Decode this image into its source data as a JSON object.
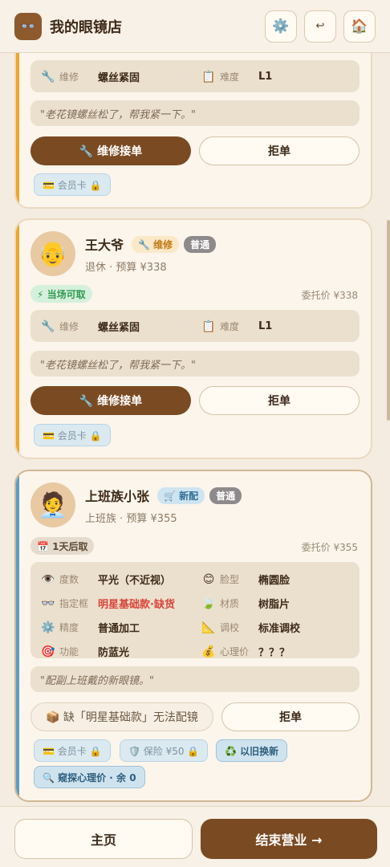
{
  "header": {
    "logo_icon": "glasses-icon",
    "title": "我的眼镜店",
    "settings_icon": "⚙️",
    "back_icon": "↩",
    "home_icon": "🏠"
  },
  "cards": [
    {
      "service": "维修",
      "service_value": "螺丝紧固",
      "difficulty_label": "难度",
      "difficulty_value": "L1",
      "quote": "\"老花镜螺丝松了，帮我紧一下。\"",
      "accept_label": "🔧 维修接单",
      "reject_label": "拒单",
      "chips": [
        "💳 会员卡 🔒"
      ]
    },
    {
      "name": "王大爷",
      "type_tag": "🔧 维修",
      "level_tag": "普通",
      "sub": "退休 · 预算 ¥338",
      "status_badge": "⚡ 当场可取",
      "commission": "委托价 ¥338",
      "service": "维修",
      "service_value": "螺丝紧固",
      "difficulty_label": "难度",
      "difficulty_value": "L1",
      "quote": "\"老花镜螺丝松了，帮我紧一下。\"",
      "accept_label": "🔧 维修接单",
      "reject_label": "拒单",
      "chips": [
        "💳 会员卡 🔒"
      ]
    },
    {
      "name": "上班族小张",
      "type_tag": "🛒 新配",
      "level_tag": "普通",
      "sub": "上班族 · 预算 ¥355",
      "status_badge": "📅 1天后取",
      "commission": "委托价 ¥355",
      "details": [
        {
          "icon": "👁️",
          "label": "度数",
          "value": "平光（不近视）"
        },
        {
          "icon": "😊",
          "label": "脸型",
          "value": "椭圆脸"
        },
        {
          "icon": "👓",
          "label": "指定框",
          "value": "明星基础款·缺货",
          "warn": true
        },
        {
          "icon": "🍃",
          "label": "材质",
          "value": "树脂片"
        },
        {
          "icon": "⚙️",
          "label": "精度",
          "value": "普通加工"
        },
        {
          "icon": "📐",
          "label": "调校",
          "value": "标准调校"
        },
        {
          "icon": "🎯",
          "label": "功能",
          "value": "防蓝光"
        },
        {
          "icon": "💰",
          "label": "心理价",
          "value": "？？？"
        }
      ],
      "quote": "\"配副上班戴的新眼镜。\"",
      "missing_label": "📦 缺「明星基础款」无法配镜",
      "reject_label": "拒单",
      "chips": [
        "💳 会员卡 🔒",
        "🛡️ 保险 ¥50 🔒",
        "♻️ 以旧换新",
        "🔍 窥探心理价 · 余 0"
      ]
    }
  ],
  "bottom": {
    "home_label": "主页",
    "end_label": "结束营业 →"
  }
}
